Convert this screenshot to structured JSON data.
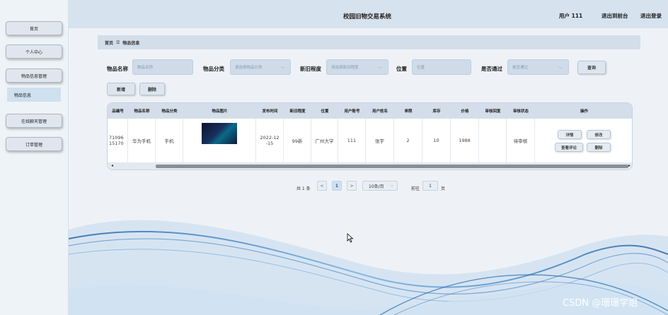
{
  "app": {
    "title": "校园旧物交易系统",
    "user": "用户 111",
    "back_label": "退出到前台",
    "logout_label": "退出登录"
  },
  "sidebar": {
    "items": [
      {
        "label": "首页"
      },
      {
        "label": "个人中心"
      },
      {
        "label": "物品信息管理"
      },
      {
        "label": "在线聊天管理"
      },
      {
        "label": "订单管理"
      }
    ],
    "submenu": {
      "label": "物品信息"
    }
  },
  "breadcrumb": {
    "home": "首页",
    "separator": "☰",
    "current": "物品信息"
  },
  "search": {
    "name_label": "物品名称",
    "name_placeholder": "物品名称",
    "category_label": "物品分类",
    "category_placeholder": "请选择物品分类",
    "condition_label": "新旧程度",
    "condition_placeholder": "请选择新旧程度",
    "location_label": "位置",
    "location_placeholder": "位置",
    "approved_label": "是否通过",
    "approved_placeholder": "是否通过",
    "query_label": "查询"
  },
  "toolbar": {
    "add_label": "新增",
    "delete_label": "删除"
  },
  "table": {
    "headers": [
      "品编号",
      "物品名称",
      "物品分类",
      "物品图片",
      "发布时间",
      "新旧程度",
      "位置",
      "用户账号",
      "用户姓名",
      "单限",
      "库存",
      "价格",
      "审核回复",
      "审核状态",
      "操作"
    ],
    "rows": [
      {
        "id": "71096\n15170",
        "name": "华为手机",
        "category": "手机",
        "image": "",
        "date": "2022-12\n-15",
        "condition": "99新",
        "location": "广州大学",
        "account": "111",
        "username": "张宇",
        "limit": "2",
        "stock": "10",
        "price": "1988",
        "reply": "",
        "status": "待审核",
        "actions": {
          "detail": "详情",
          "edit": "修改",
          "comments": "查看评论",
          "delete": "删除"
        }
      }
    ]
  },
  "pagination": {
    "total": "共 1 条",
    "prev": "<",
    "current": "1",
    "next": ">",
    "page_size": "10条/页",
    "goto_label": "前往",
    "goto_value": "1",
    "page_unit": "页"
  },
  "watermark": "CSDN @珊珊学姐",
  "colors": {
    "header_bg": "#d6e2ee",
    "sidebar_bg": "#eef3f7",
    "table_header": "#d3deea",
    "wave": "#2a6fb0"
  }
}
